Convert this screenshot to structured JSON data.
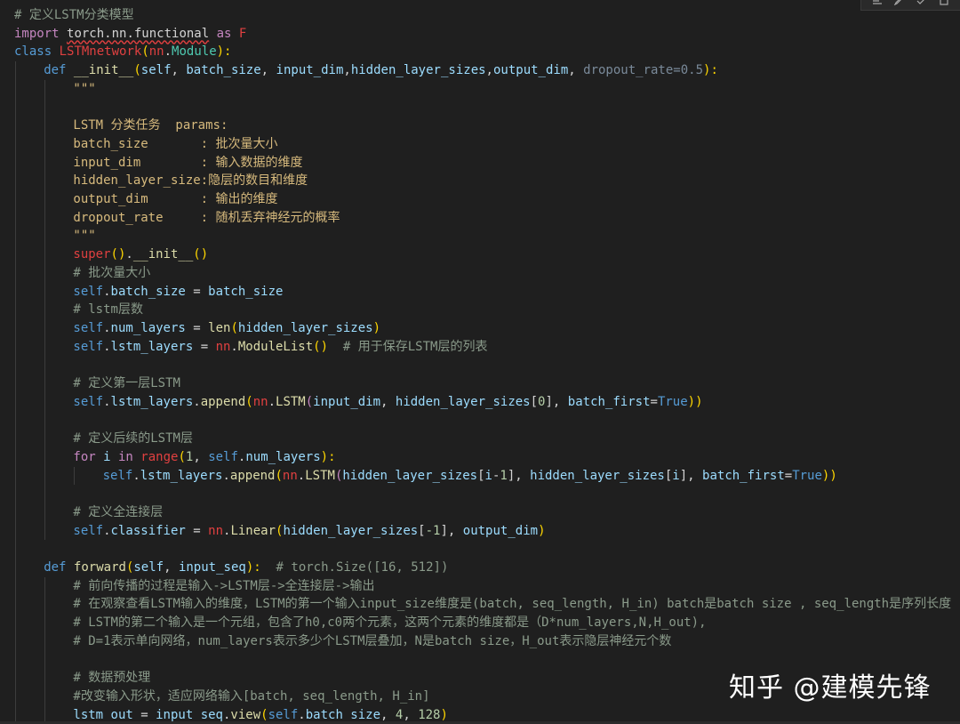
{
  "watermark": "知乎 @建模先锋",
  "toolbar": {
    "icons": [
      "collapse-icon",
      "edit-icon",
      "check-icon",
      "copy-icon"
    ]
  },
  "lines": [
    {
      "indent": 0,
      "tokens": [
        {
          "t": "# 定义LSTM分类模型",
          "c": "com"
        }
      ]
    },
    {
      "indent": 0,
      "tokens": [
        {
          "t": "import",
          "c": "kw"
        },
        {
          "t": " ",
          "c": "punc"
        },
        {
          "t": "torch.nn.functional",
          "c": "punc",
          "u": true
        },
        {
          "t": " ",
          "c": "punc"
        },
        {
          "t": "as",
          "c": "kw"
        },
        {
          "t": " F",
          "c": "err"
        }
      ]
    },
    {
      "indent": 0,
      "tokens": [
        {
          "t": "class",
          "c": "kw2"
        },
        {
          "t": " ",
          "c": "punc"
        },
        {
          "t": "LSTMnetwork",
          "c": "err"
        },
        {
          "t": "(",
          "c": "paren"
        },
        {
          "t": "nn",
          "c": "err"
        },
        {
          "t": ".",
          "c": "punc"
        },
        {
          "t": "Module",
          "c": "cls"
        },
        {
          "t": "):",
          "c": "paren"
        }
      ]
    },
    {
      "indent": 1,
      "tokens": [
        {
          "t": "def",
          "c": "kw2"
        },
        {
          "t": " ",
          "c": "punc"
        },
        {
          "t": "__init__",
          "c": "func"
        },
        {
          "t": "(",
          "c": "paren"
        },
        {
          "t": "self",
          "c": "param"
        },
        {
          "t": ", ",
          "c": "punc"
        },
        {
          "t": "batch_size",
          "c": "param"
        },
        {
          "t": ", ",
          "c": "punc"
        },
        {
          "t": "input_dim",
          "c": "param"
        },
        {
          "t": ",",
          "c": "punc"
        },
        {
          "t": "hidden_layer_sizes",
          "c": "param"
        },
        {
          "t": ",",
          "c": "punc"
        },
        {
          "t": "output_dim",
          "c": "param"
        },
        {
          "t": ", ",
          "c": "punc"
        },
        {
          "t": "dropout_rate",
          "c": "faint"
        },
        {
          "t": "=",
          "c": "faint"
        },
        {
          "t": "0.5",
          "c": "faint"
        },
        {
          "t": "):",
          "c": "paren"
        }
      ]
    },
    {
      "indent": 2,
      "tokens": [
        {
          "t": "\"\"\"",
          "c": "doc"
        }
      ]
    },
    {
      "indent": 2,
      "tokens": []
    },
    {
      "indent": 2,
      "tokens": [
        {
          "t": "LSTM 分类任务  params:",
          "c": "doc"
        }
      ]
    },
    {
      "indent": 2,
      "tokens": [
        {
          "t": "batch_size       : 批次量大小",
          "c": "doc"
        }
      ]
    },
    {
      "indent": 2,
      "tokens": [
        {
          "t": "input_dim        : 输入数据的维度",
          "c": "doc"
        }
      ]
    },
    {
      "indent": 2,
      "tokens": [
        {
          "t": "hidden_layer_size:隐层的数目和维度",
          "c": "doc"
        }
      ]
    },
    {
      "indent": 2,
      "tokens": [
        {
          "t": "output_dim       : 输出的维度",
          "c": "doc"
        }
      ]
    },
    {
      "indent": 2,
      "tokens": [
        {
          "t": "dropout_rate     : 随机丢弃神经元的概率",
          "c": "doc"
        }
      ]
    },
    {
      "indent": 2,
      "tokens": [
        {
          "t": "\"\"\"",
          "c": "doc"
        }
      ]
    },
    {
      "indent": 2,
      "tokens": [
        {
          "t": "super",
          "c": "err"
        },
        {
          "t": "()",
          "c": "paren"
        },
        {
          "t": ".",
          "c": "punc"
        },
        {
          "t": "__init__",
          "c": "func"
        },
        {
          "t": "()",
          "c": "paren"
        }
      ]
    },
    {
      "indent": 2,
      "tokens": [
        {
          "t": "# 批次量大小",
          "c": "com"
        }
      ]
    },
    {
      "indent": 2,
      "tokens": [
        {
          "t": "self",
          "c": "self"
        },
        {
          "t": ".",
          "c": "punc"
        },
        {
          "t": "batch_size",
          "c": "param"
        },
        {
          "t": " = ",
          "c": "punc"
        },
        {
          "t": "batch_size",
          "c": "param"
        }
      ]
    },
    {
      "indent": 2,
      "tokens": [
        {
          "t": "# lstm层数",
          "c": "com"
        }
      ]
    },
    {
      "indent": 2,
      "tokens": [
        {
          "t": "self",
          "c": "self"
        },
        {
          "t": ".",
          "c": "punc"
        },
        {
          "t": "num_layers",
          "c": "param"
        },
        {
          "t": " = ",
          "c": "punc"
        },
        {
          "t": "len",
          "c": "func"
        },
        {
          "t": "(",
          "c": "paren"
        },
        {
          "t": "hidden_layer_sizes",
          "c": "param"
        },
        {
          "t": ")",
          "c": "paren"
        }
      ]
    },
    {
      "indent": 2,
      "tokens": [
        {
          "t": "self",
          "c": "self"
        },
        {
          "t": ".",
          "c": "punc"
        },
        {
          "t": "lstm_layers",
          "c": "param"
        },
        {
          "t": " = ",
          "c": "punc"
        },
        {
          "t": "nn",
          "c": "err"
        },
        {
          "t": ".",
          "c": "punc"
        },
        {
          "t": "ModuleList",
          "c": "func"
        },
        {
          "t": "()",
          "c": "paren"
        },
        {
          "t": "  ",
          "c": "punc"
        },
        {
          "t": "# 用于保存LSTM层的列表",
          "c": "com"
        }
      ]
    },
    {
      "indent": 2,
      "tokens": []
    },
    {
      "indent": 2,
      "tokens": [
        {
          "t": "# 定义第一层LSTM",
          "c": "com"
        }
      ]
    },
    {
      "indent": 2,
      "tokens": [
        {
          "t": "self",
          "c": "self"
        },
        {
          "t": ".",
          "c": "punc"
        },
        {
          "t": "lstm_layers",
          "c": "param"
        },
        {
          "t": ".",
          "c": "punc"
        },
        {
          "t": "append",
          "c": "func"
        },
        {
          "t": "(",
          "c": "paren"
        },
        {
          "t": "nn",
          "c": "err"
        },
        {
          "t": ".",
          "c": "punc"
        },
        {
          "t": "LSTM",
          "c": "func"
        },
        {
          "t": "(",
          "c": "kw"
        },
        {
          "t": "input_dim",
          "c": "param"
        },
        {
          "t": ", ",
          "c": "punc"
        },
        {
          "t": "hidden_layer_sizes",
          "c": "param"
        },
        {
          "t": "[",
          "c": "punc"
        },
        {
          "t": "0",
          "c": "num"
        },
        {
          "t": "]",
          "c": "punc"
        },
        {
          "t": ", ",
          "c": "punc"
        },
        {
          "t": "batch_first",
          "c": "param"
        },
        {
          "t": "=",
          "c": "punc"
        },
        {
          "t": "True",
          "c": "bool"
        },
        {
          "t": "))",
          "c": "paren"
        }
      ]
    },
    {
      "indent": 2,
      "tokens": []
    },
    {
      "indent": 2,
      "tokens": [
        {
          "t": "# 定义后续的LSTM层",
          "c": "com"
        }
      ]
    },
    {
      "indent": 2,
      "tokens": [
        {
          "t": "for",
          "c": "kw"
        },
        {
          "t": " ",
          "c": "punc"
        },
        {
          "t": "i",
          "c": "param"
        },
        {
          "t": " ",
          "c": "punc"
        },
        {
          "t": "in",
          "c": "kw"
        },
        {
          "t": " ",
          "c": "punc"
        },
        {
          "t": "range",
          "c": "err"
        },
        {
          "t": "(",
          "c": "paren"
        },
        {
          "t": "1",
          "c": "num"
        },
        {
          "t": ", ",
          "c": "punc"
        },
        {
          "t": "self",
          "c": "self"
        },
        {
          "t": ".",
          "c": "punc"
        },
        {
          "t": "num_layers",
          "c": "param"
        },
        {
          "t": "):",
          "c": "paren"
        }
      ]
    },
    {
      "indent": 3,
      "tokens": [
        {
          "t": "self",
          "c": "self"
        },
        {
          "t": ".",
          "c": "punc"
        },
        {
          "t": "lstm_layers",
          "c": "param"
        },
        {
          "t": ".",
          "c": "punc"
        },
        {
          "t": "append",
          "c": "func"
        },
        {
          "t": "(",
          "c": "paren"
        },
        {
          "t": "nn",
          "c": "err"
        },
        {
          "t": ".",
          "c": "punc"
        },
        {
          "t": "LSTM",
          "c": "func"
        },
        {
          "t": "(",
          "c": "kw"
        },
        {
          "t": "hidden_layer_sizes",
          "c": "param"
        },
        {
          "t": "[",
          "c": "punc"
        },
        {
          "t": "i",
          "c": "param"
        },
        {
          "t": "-",
          "c": "punc"
        },
        {
          "t": "1",
          "c": "num"
        },
        {
          "t": "]",
          "c": "punc"
        },
        {
          "t": ", ",
          "c": "punc"
        },
        {
          "t": "hidden_layer_sizes",
          "c": "param"
        },
        {
          "t": "[",
          "c": "punc"
        },
        {
          "t": "i",
          "c": "param"
        },
        {
          "t": "]",
          "c": "punc"
        },
        {
          "t": ", ",
          "c": "punc"
        },
        {
          "t": "batch_first",
          "c": "param"
        },
        {
          "t": "=",
          "c": "punc"
        },
        {
          "t": "True",
          "c": "bool"
        },
        {
          "t": "))",
          "c": "paren"
        }
      ]
    },
    {
      "indent": 2,
      "tokens": []
    },
    {
      "indent": 2,
      "tokens": [
        {
          "t": "# 定义全连接层",
          "c": "com"
        }
      ]
    },
    {
      "indent": 2,
      "tokens": [
        {
          "t": "self",
          "c": "self"
        },
        {
          "t": ".",
          "c": "punc"
        },
        {
          "t": "classifier",
          "c": "param"
        },
        {
          "t": " = ",
          "c": "punc"
        },
        {
          "t": "nn",
          "c": "err"
        },
        {
          "t": ".",
          "c": "punc"
        },
        {
          "t": "Linear",
          "c": "func"
        },
        {
          "t": "(",
          "c": "paren"
        },
        {
          "t": "hidden_layer_sizes",
          "c": "param"
        },
        {
          "t": "[",
          "c": "punc"
        },
        {
          "t": "-1",
          "c": "num"
        },
        {
          "t": "]",
          "c": "punc"
        },
        {
          "t": ", ",
          "c": "punc"
        },
        {
          "t": "output_dim",
          "c": "param"
        },
        {
          "t": ")",
          "c": "paren"
        }
      ]
    },
    {
      "indent": 1,
      "tokens": []
    },
    {
      "indent": 1,
      "tokens": [
        {
          "t": "def",
          "c": "kw2"
        },
        {
          "t": " ",
          "c": "punc"
        },
        {
          "t": "forward",
          "c": "func"
        },
        {
          "t": "(",
          "c": "paren"
        },
        {
          "t": "self",
          "c": "param"
        },
        {
          "t": ", ",
          "c": "punc"
        },
        {
          "t": "input_seq",
          "c": "param"
        },
        {
          "t": "):",
          "c": "paren"
        },
        {
          "t": "  ",
          "c": "punc"
        },
        {
          "t": "# torch.Size([16, 512])",
          "c": "com"
        }
      ]
    },
    {
      "indent": 2,
      "tokens": [
        {
          "t": "# 前向传播的过程是输入->LSTM层->全连接层->输出",
          "c": "com"
        }
      ]
    },
    {
      "indent": 2,
      "tokens": [
        {
          "t": "# 在观察查看LSTM输入的维度，LSTM的第一个输入input_size维度是(batch, seq_length, H_in) batch是batch size , seq_length是序列长度",
          "c": "com"
        }
      ]
    },
    {
      "indent": 2,
      "tokens": [
        {
          "t": "# LSTM的第二个输入是一个元组，包含了h0,c0两个元素，这两个元素的维度都是（D*num_layers,N,H_out),",
          "c": "com"
        }
      ]
    },
    {
      "indent": 2,
      "tokens": [
        {
          "t": "# D=1表示单向网络，num_layers表示多少个LSTM层叠加，N是batch size，H_out表示隐层神经元个数",
          "c": "com"
        }
      ]
    },
    {
      "indent": 2,
      "tokens": []
    },
    {
      "indent": 2,
      "tokens": [
        {
          "t": "# 数据预处理",
          "c": "com"
        }
      ]
    },
    {
      "indent": 2,
      "tokens": [
        {
          "t": "#改变输入形状，适应网络输入[batch, seq_length, H_in]",
          "c": "com"
        }
      ]
    },
    {
      "indent": 2,
      "tokens": [
        {
          "t": "lstm_out",
          "c": "param"
        },
        {
          "t": " = ",
          "c": "punc"
        },
        {
          "t": "input_seq",
          "c": "param"
        },
        {
          "t": ".",
          "c": "punc"
        },
        {
          "t": "view",
          "c": "func"
        },
        {
          "t": "(",
          "c": "paren"
        },
        {
          "t": "self",
          "c": "self"
        },
        {
          "t": ".",
          "c": "punc"
        },
        {
          "t": "batch_size",
          "c": "param"
        },
        {
          "t": ", ",
          "c": "punc"
        },
        {
          "t": "4",
          "c": "num"
        },
        {
          "t": ", ",
          "c": "punc"
        },
        {
          "t": "128",
          "c": "num"
        },
        {
          "t": ")",
          "c": "paren"
        }
      ]
    }
  ]
}
